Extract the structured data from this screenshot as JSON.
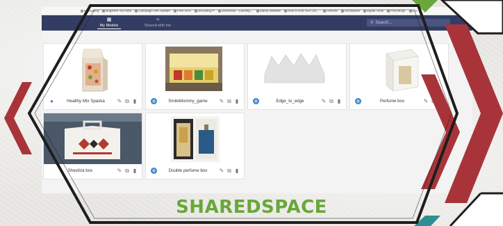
{
  "bookmarks": [
    "Everything",
    "Bugsfree YouTube",
    "Campaign URL Builder",
    "Free SVG",
    "Decoding IT",
    "Elementor - Landing...",
    "Stamp Website",
    "How to Edit Your Cre...",
    "CRKelle",
    "ClickBoard",
    "Digital Tools",
    "Post Blogs",
    "Loc"
  ],
  "tabs": [
    {
      "label": "My Models",
      "icon": "grid-icon",
      "active": true
    },
    {
      "label": "Shared with me",
      "icon": "share-icon",
      "active": false
    }
  ],
  "search": {
    "placeholder": "Search..."
  },
  "models": [
    {
      "name": "Healthy Mix Spaska",
      "visibility": "private"
    },
    {
      "name": "SmileMommy_game",
      "visibility": "public"
    },
    {
      "name": "Edge_to_edge",
      "visibility": "public"
    },
    {
      "name": "Perfume box",
      "visibility": "public"
    },
    {
      "name": "Shevitza box",
      "visibility": "public"
    },
    {
      "name": "Double perfume box",
      "visibility": "public"
    }
  ],
  "headline": "SHAREDSPACE",
  "colors": {
    "accent": "#6aa63a",
    "red": "#a8343a",
    "teal": "#2f8f93",
    "navy": "#333d64",
    "outline": "#1e1e1e"
  }
}
